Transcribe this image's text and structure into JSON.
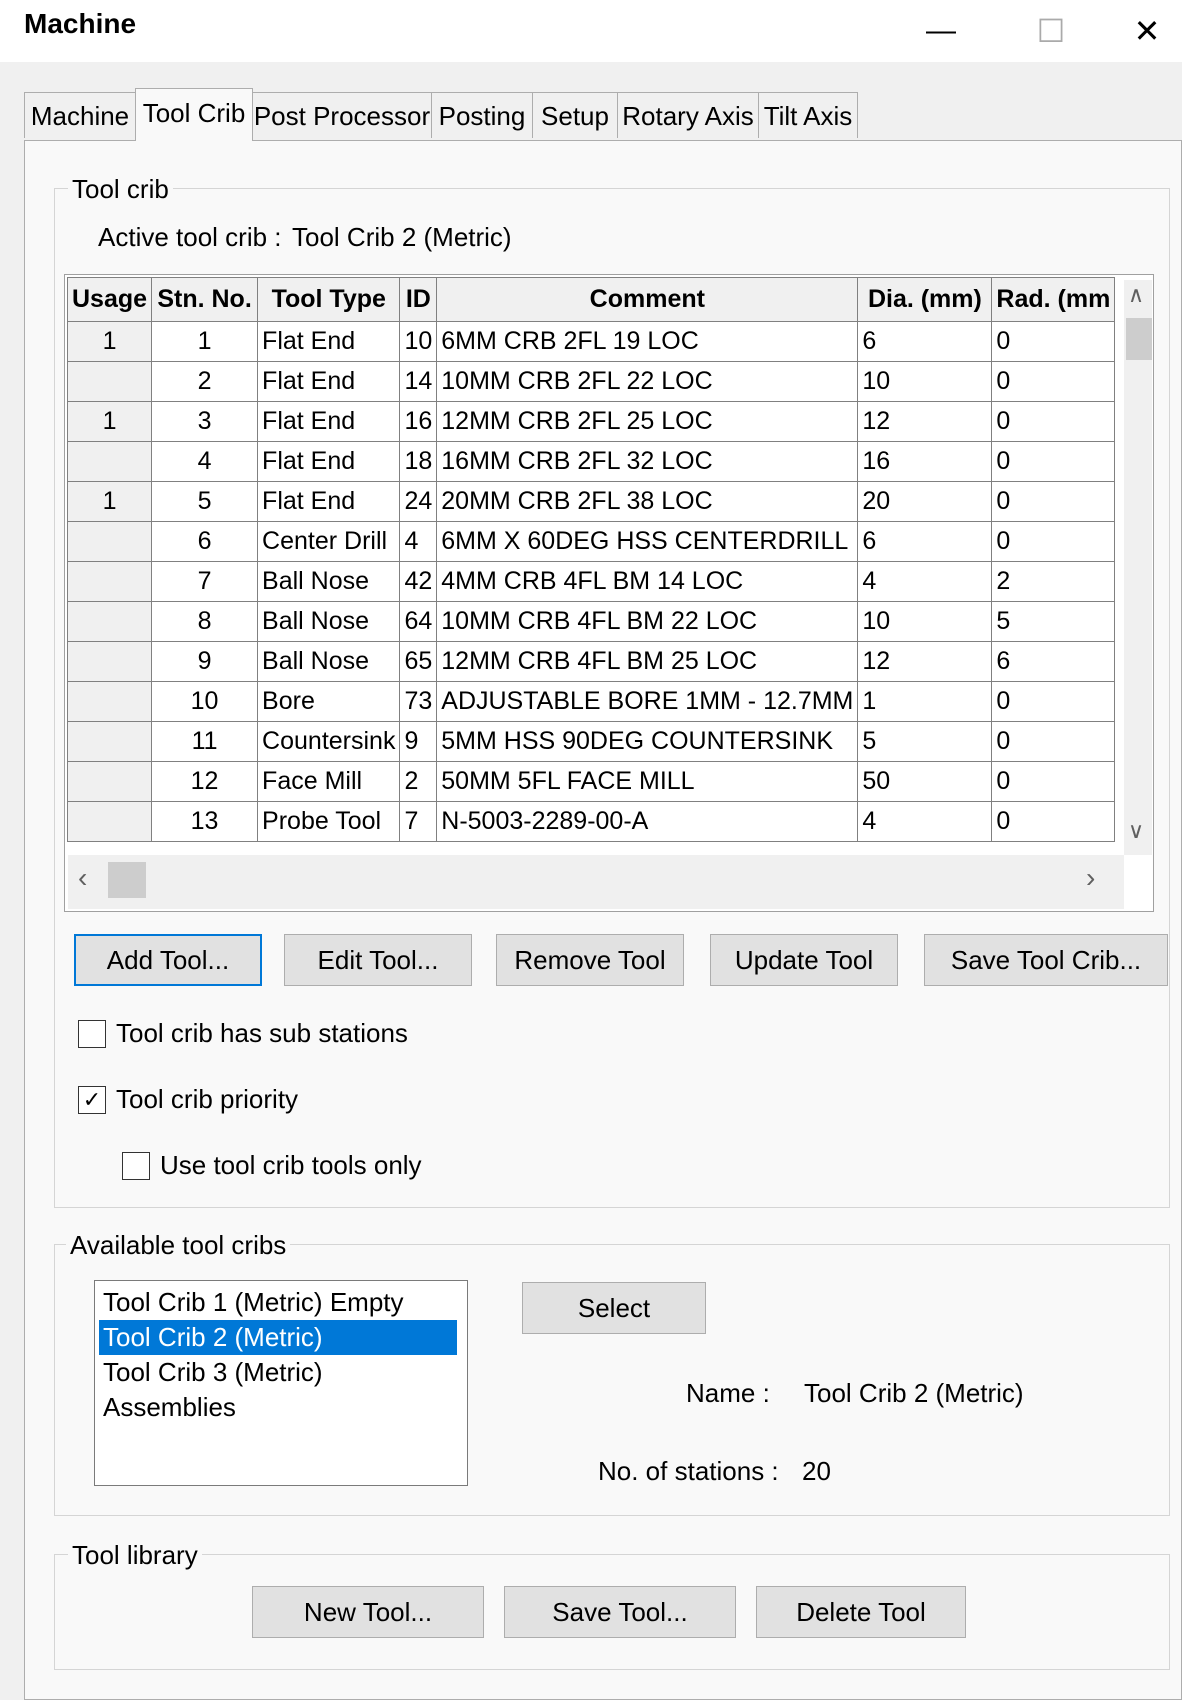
{
  "window": {
    "title": "Machine",
    "minimize_glyph": "—",
    "maximize_glyph": "☐",
    "close_glyph": "✕"
  },
  "tabs": [
    {
      "label": "Machine"
    },
    {
      "label": "Tool Crib"
    },
    {
      "label": "Post Processor"
    },
    {
      "label": "Posting"
    },
    {
      "label": "Setup"
    },
    {
      "label": "Rotary Axis"
    },
    {
      "label": "Tilt Axis"
    }
  ],
  "tool_crib": {
    "legend": "Tool crib",
    "active_label": "Active tool crib :",
    "active_value": "Tool Crib 2 (Metric)",
    "columns": [
      "Usage",
      "Stn. No.",
      "Tool Type",
      "ID",
      "Comment",
      "Dia. (mm)",
      "Rad. (mm"
    ],
    "rows": [
      {
        "usage": "1",
        "stn": "1",
        "type": "Flat End",
        "id": "10",
        "comment": "6MM CRB 2FL 19 LOC",
        "dia": "6",
        "rad": "0"
      },
      {
        "usage": "",
        "stn": "2",
        "type": "Flat End",
        "id": "14",
        "comment": "10MM CRB 2FL 22 LOC",
        "dia": "10",
        "rad": "0"
      },
      {
        "usage": "1",
        "stn": "3",
        "type": "Flat End",
        "id": "16",
        "comment": "12MM CRB 2FL 25 LOC",
        "dia": "12",
        "rad": "0"
      },
      {
        "usage": "",
        "stn": "4",
        "type": "Flat End",
        "id": "18",
        "comment": "16MM CRB 2FL 32 LOC",
        "dia": "16",
        "rad": "0"
      },
      {
        "usage": "1",
        "stn": "5",
        "type": "Flat End",
        "id": "24",
        "comment": "20MM CRB 2FL 38 LOC",
        "dia": "20",
        "rad": "0"
      },
      {
        "usage": "",
        "stn": "6",
        "type": "Center Drill",
        "id": "4",
        "comment": "6MM X 60DEG HSS CENTERDRILL",
        "dia": "6",
        "rad": "0"
      },
      {
        "usage": "",
        "stn": "7",
        "type": "Ball Nose",
        "id": "42",
        "comment": "4MM CRB 4FL BM 14 LOC",
        "dia": "4",
        "rad": "2"
      },
      {
        "usage": "",
        "stn": "8",
        "type": "Ball Nose",
        "id": "64",
        "comment": "10MM CRB 4FL BM 22 LOC",
        "dia": "10",
        "rad": "5"
      },
      {
        "usage": "",
        "stn": "9",
        "type": "Ball Nose",
        "id": "65",
        "comment": "12MM CRB 4FL BM 25 LOC",
        "dia": "12",
        "rad": "6"
      },
      {
        "usage": "",
        "stn": "10",
        "type": "Bore",
        "id": "73",
        "comment": "ADJUSTABLE BORE 1MM - 12.7MM",
        "dia": "1",
        "rad": "0"
      },
      {
        "usage": "",
        "stn": "11",
        "type": "Countersink",
        "id": "9",
        "comment": "5MM HSS 90DEG COUNTERSINK",
        "dia": "5",
        "rad": "0"
      },
      {
        "usage": "",
        "stn": "12",
        "type": "Face Mill",
        "id": "2",
        "comment": "50MM 5FL FACE MILL",
        "dia": "50",
        "rad": "0"
      },
      {
        "usage": "",
        "stn": "13",
        "type": "Probe Tool",
        "id": "7",
        "comment": "N-5003-2289-00-A",
        "dia": "4",
        "rad": "0"
      }
    ],
    "buttons": {
      "add": "Add Tool...",
      "edit": "Edit Tool...",
      "remove": "Remove Tool",
      "update": "Update Tool",
      "save": "Save Tool Crib..."
    },
    "checkboxes": {
      "sub_stations": {
        "label": "Tool crib has sub stations",
        "checked": false
      },
      "priority": {
        "label": "Tool crib priority",
        "checked": true
      },
      "tools_only": {
        "label": "Use tool crib tools only",
        "checked": false
      }
    }
  },
  "available": {
    "legend": "Available tool cribs",
    "items": [
      {
        "label": "Tool Crib 1 (Metric) Empty",
        "selected": false
      },
      {
        "label": "Tool Crib 2 (Metric)",
        "selected": true
      },
      {
        "label": "Tool Crib 3 (Metric) Assemblies",
        "selected": false
      }
    ],
    "select_button": "Select",
    "name_label": "Name :",
    "name_value": "Tool Crib 2 (Metric)",
    "stations_label": "No. of stations :",
    "stations_value": "20"
  },
  "tool_library": {
    "legend": "Tool library",
    "new_button": "New Tool...",
    "save_button": "Save Tool...",
    "delete_button": "Delete Tool"
  },
  "colors": {
    "selection": "#0078d7",
    "window_bg": "#f0f0f0",
    "panel_bg": "#f9f9f9"
  }
}
